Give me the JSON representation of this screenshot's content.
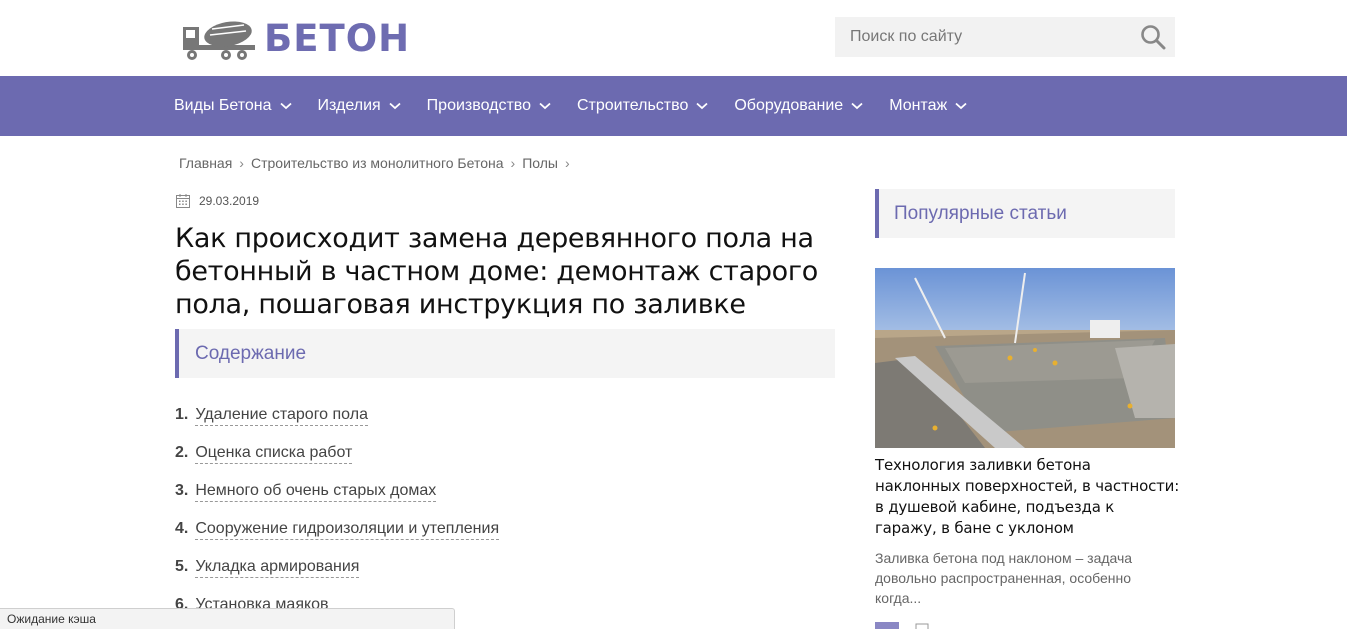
{
  "logo": {
    "text": "БЕТОН"
  },
  "search": {
    "placeholder": "Поиск по сайту"
  },
  "nav": {
    "items": [
      {
        "label": "Виды Бетона"
      },
      {
        "label": "Изделия"
      },
      {
        "label": "Производство"
      },
      {
        "label": "Строительство"
      },
      {
        "label": "Оборудование"
      },
      {
        "label": "Монтаж"
      }
    ]
  },
  "breadcrumb": {
    "items": [
      {
        "label": "Главная"
      },
      {
        "label": "Строительство из монолитного Бетона"
      },
      {
        "label": "Полы"
      }
    ],
    "separator": "›"
  },
  "article": {
    "date": "29.03.2019",
    "title": "Как происходит замена деревянного пола на бетонный в частном доме: демонтаж старого пола, пошаговая инструкция по заливке",
    "toc_heading": "Содержание",
    "toc": [
      {
        "num": "1.",
        "label": "Удаление старого пола"
      },
      {
        "num": "2.",
        "label": "Оценка списка работ"
      },
      {
        "num": "3.",
        "label": "Немного об очень старых домах"
      },
      {
        "num": "4.",
        "label": "Сооружение гидроизоляции и утепления"
      },
      {
        "num": "5.",
        "label": "Укладка армирования"
      },
      {
        "num": "6.",
        "label": "Установка маяков"
      }
    ]
  },
  "sidebar": {
    "heading": "Популярные статьи",
    "post": {
      "title": "Технология заливки бетона наклонных поверхностей, в частности: в душевой кабине, подъезда к гаражу, в бане с уклоном",
      "excerpt": "Заливка бетона под наклоном – задача довольно распространенная, особенно когда..."
    }
  },
  "status": {
    "text": "Ожидание кэша"
  },
  "colors": {
    "accent": "#6c6ab0",
    "panel": "#f4f4f4"
  }
}
